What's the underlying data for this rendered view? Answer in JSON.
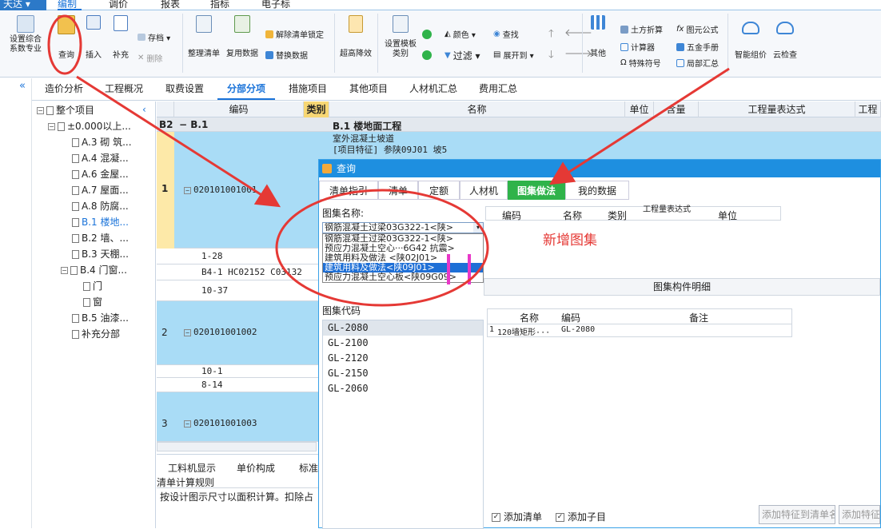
{
  "app": {
    "menu_label": "天达 ▾"
  },
  "menubar": {
    "items": [
      "编制",
      "调价",
      "报表",
      "指标",
      "电子标"
    ],
    "active_index": 0
  },
  "ribbon": {
    "btn_settings": "设置综合\n系数专业",
    "btn_query": "查询",
    "btn_insert": "插入",
    "btn_supplement": "补充",
    "btn_archive": "存档 ▾",
    "btn_delete": "删除",
    "btn_arrange": "整理清单",
    "btn_reuse": "复用数据",
    "btn_unlock": "解除清单锁定",
    "btn_replace": "替换数据",
    "btn_super": "超高降效",
    "btn_template": "设置模板\n类别",
    "btn_color": "颜色 ▾",
    "btn_find": "查找",
    "btn_filter": "过滤 ▾",
    "btn_expand": "展开到 ▾",
    "btn_other": "其他",
    "btn_earth": "土方折算",
    "btn_formula": "图元公式",
    "btn_calc": "计算器",
    "btn_manual": "五金手册",
    "btn_symbol": "特殊符号",
    "btn_summary": "局部汇总",
    "btn_smart": "智能组价",
    "btn_cloud": "云检查"
  },
  "navtabs": [
    "造价分析",
    "工程概况",
    "取费设置",
    "分部分项",
    "措施项目",
    "其他项目",
    "人材机汇总",
    "费用汇总"
  ],
  "navtabs_active": 3,
  "tree": {
    "root": "整个项目",
    "level1": "±0.000以上...",
    "items": [
      "A.3 砌 筑...",
      "A.4 混凝...",
      "A.6 金屋...",
      "A.7 屋面...",
      "A.8 防腐...",
      "B.1 楼地...",
      "B.2 墙、...",
      "B.3 天棚...",
      "B.4 门窗..."
    ],
    "sub_items": [
      "门",
      "窗"
    ],
    "tail_items": [
      "B.5 油漆...",
      "补充分部"
    ],
    "selected_index": 5
  },
  "grid": {
    "headers": {
      "code": "编码",
      "type": "类别",
      "name": "名称",
      "unit": "单位",
      "qty": "含量",
      "expr": "工程量表达式",
      "extra": "工程"
    },
    "group_no": "B2",
    "group_code": "B.1",
    "group_name": "B.1  楼地面工程",
    "row1": {
      "no": "1",
      "code": "020101001001",
      "name1": "室外混凝土坡道",
      "name2": "[项目特征]  参陕09J01 坡5"
    },
    "row1_subs": [
      "1-28",
      "B4-1 HC02152 C03132",
      "10-37"
    ],
    "row2": {
      "no": "2",
      "code": "020101001002"
    },
    "row2_subs": [
      "10-1",
      "8-14"
    ],
    "row3": {
      "no": "3",
      "code": "020101001003"
    }
  },
  "bottom": {
    "tabs": [
      "工料机显示",
      "单价构成",
      "标准"
    ],
    "rule_title": "清单计算规则",
    "rule_text": "按设计图示尺寸以面积计算。扣除占"
  },
  "dialog": {
    "title": "查询",
    "tabs": [
      "清单指引",
      "清单",
      "定额",
      "人材机",
      "图集做法",
      "我的数据"
    ],
    "active_tab": 4,
    "atlas_label": "图集名称:",
    "selected_option": "钢筋混凝土过梁03G322-1<陕>",
    "options": [
      "钢筋混凝土过梁03G322-1<陕>",
      "预应力混凝土空心···6G42 抗震>",
      "建筑用料及做法 <陕02J01>",
      "建筑用料及做法<陕09J01>",
      "预应力混凝土空心板<陕09G09>"
    ],
    "highlighted_option": 3,
    "right_headers": [
      "编码",
      "名称",
      "类别",
      "工程量表达式",
      "单位"
    ],
    "annotation": "新增图集",
    "atlas_code_label": "图集代码",
    "codes": [
      "GL-2080",
      "GL-2100",
      "GL-2120",
      "GL-2150",
      "GL-2060"
    ],
    "detail_title": "图集构件明细",
    "detail_headers": [
      "名称",
      "编码",
      "备注"
    ],
    "detail_row": {
      "no": "1",
      "name": "120墙矩形···",
      "code": "GL-2080"
    },
    "chk_list": "添加清单",
    "chk_sub": "添加子目",
    "btn_add_list": "添加特征到清单名称",
    "btn_add_feat": "添加特征到"
  },
  "colors": {
    "accent": "#1a73d9",
    "row_blue": "#a9dcf6",
    "annotation_red": "#e53935",
    "active_tab_green": "#2fb34a"
  }
}
